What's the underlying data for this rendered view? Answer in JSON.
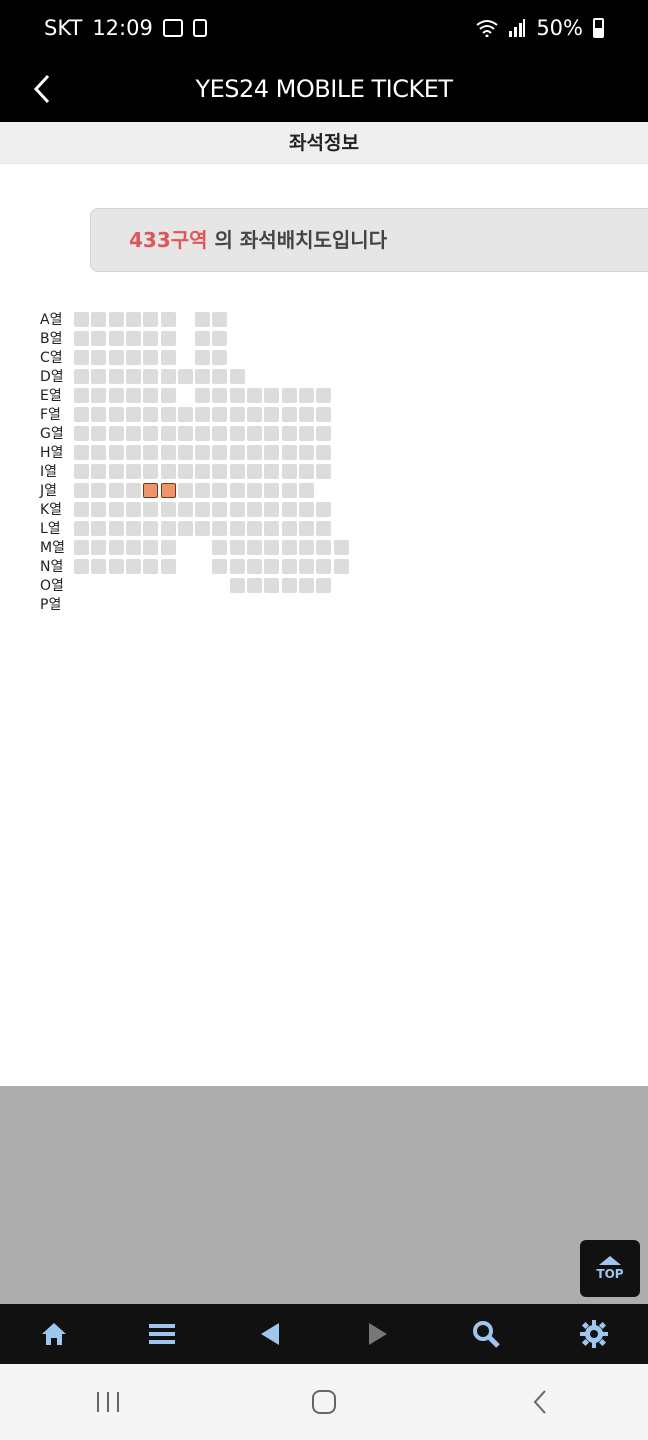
{
  "status_bar": {
    "carrier": "SKT",
    "time": "12:09",
    "battery": "50%"
  },
  "header": {
    "title": "YES24 MOBILE TICKET"
  },
  "subheader": {
    "title": "좌석정보"
  },
  "notice": {
    "zone": "433구역",
    "text": " 의 좌석배치도입니다"
  },
  "seat_map": {
    "rows": [
      "A열",
      "B열",
      "C열",
      "D열",
      "E열",
      "F열",
      "G열",
      "H열",
      "I열",
      "J열",
      "K열",
      "L열",
      "M열",
      "N열",
      "O열",
      "P열"
    ],
    "layout": [
      "111111.11......",
      "111111.11......",
      "111111.11......",
      "1111111111.....",
      "111111.11111111",
      "111111111111111",
      "111111111111111",
      "111111111111111",
      "111111111111111",
      "11115511111111",
      "111111111111111",
      "111111111111111",
      "111111..11111111",
      "111111..11111111",
      ".........111111",
      "..............."
    ],
    "selected_color": "#f0956a",
    "seat_color": "#dcdcdc"
  },
  "top_button": {
    "label": "TOP"
  },
  "toolbar": {
    "items": [
      "home-icon",
      "menu-icon",
      "back-arrow-icon",
      "forward-arrow-icon",
      "search-icon",
      "gear-icon"
    ]
  },
  "colors": {
    "accent": "#5b9ee0",
    "zone": "#e05555"
  }
}
